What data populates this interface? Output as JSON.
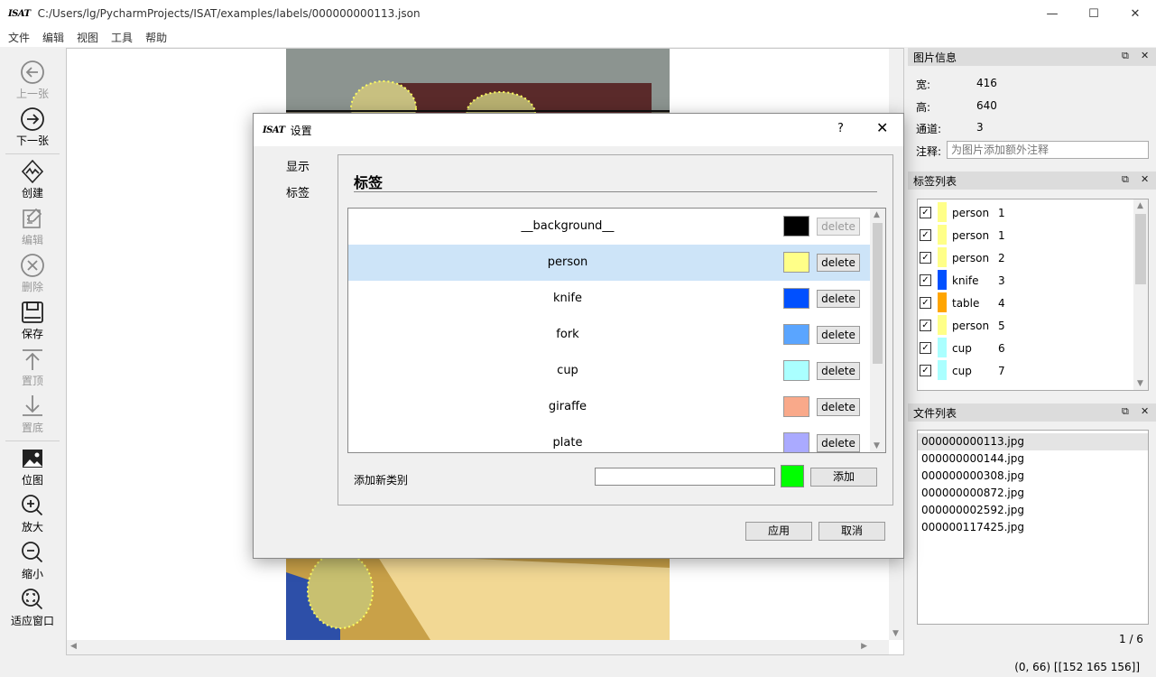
{
  "window": {
    "logo": "ISAT",
    "title": "C:/Users/lg/PycharmProjects/ISAT/examples/labels/000000000113.json",
    "controls": [
      "—",
      "☐",
      "✕"
    ]
  },
  "menu": [
    "文件",
    "编辑",
    "视图",
    "工具",
    "帮助"
  ],
  "toolbar": {
    "prev": "上一张",
    "next": "下一张",
    "create": "创建",
    "edit": "编辑",
    "delete": "删除",
    "save": "保存",
    "to_top": "置顶",
    "to_bottom": "置底",
    "bitmap": "位图",
    "zoom_in": "放大",
    "zoom_out": "缩小",
    "fit_window": "适应窗口"
  },
  "image_info": {
    "title": "图片信息",
    "width_label": "宽:",
    "width": "416",
    "height_label": "高:",
    "height": "640",
    "channels_label": "通道:",
    "channels": "3",
    "note_label": "注释:",
    "note_placeholder": "为图片添加额外注释"
  },
  "label_list": {
    "title": "标签列表",
    "items": [
      {
        "name": "person",
        "group": "1",
        "color": "#ffff88",
        "checked": true
      },
      {
        "name": "person",
        "group": "1",
        "color": "#ffff88",
        "checked": true
      },
      {
        "name": "person",
        "group": "2",
        "color": "#ffff88",
        "checked": true
      },
      {
        "name": "knife",
        "group": "3",
        "color": "#0050ff",
        "checked": true
      },
      {
        "name": "table",
        "group": "4",
        "color": "#ffa500",
        "checked": true
      },
      {
        "name": "person",
        "group": "5",
        "color": "#ffff88",
        "checked": true
      },
      {
        "name": "cup",
        "group": "6",
        "color": "#aaffff",
        "checked": true
      },
      {
        "name": "cup",
        "group": "7",
        "color": "#aaffff",
        "checked": true
      }
    ]
  },
  "file_list": {
    "title": "文件列表",
    "files": [
      "000000000113.jpg",
      "000000000144.jpg",
      "000000000308.jpg",
      "000000000872.jpg",
      "000000002592.jpg",
      "000000117425.jpg"
    ],
    "selected_index": 0,
    "counter": "1 / 6"
  },
  "status": {
    "text": "(0, 66) [[152 165 156]]"
  },
  "dialog": {
    "title": "设置",
    "help": "?",
    "close": "✕",
    "nav": [
      "显示",
      "标签"
    ],
    "section_title": "标签",
    "labels": [
      {
        "name": "__background__",
        "color": "#000000",
        "delete": "delete",
        "deletable": false
      },
      {
        "name": "person",
        "color": "#ffff88",
        "delete": "delete",
        "deletable": true
      },
      {
        "name": "knife",
        "color": "#0050ff",
        "delete": "delete",
        "deletable": true
      },
      {
        "name": "fork",
        "color": "#5aa5ff",
        "delete": "delete",
        "deletable": true
      },
      {
        "name": "cup",
        "color": "#aaffff",
        "delete": "delete",
        "deletable": true
      },
      {
        "name": "giraffe",
        "color": "#f9a98a",
        "delete": "delete",
        "deletable": true
      },
      {
        "name": "plate",
        "color": "#aaaaff",
        "delete": "delete",
        "deletable": true
      }
    ],
    "selected_label_index": 1,
    "add_label_text": "添加新类别",
    "add_input_value": "",
    "add_color": "#00ff00",
    "add_button": "添加",
    "apply": "应用",
    "cancel": "取消"
  }
}
